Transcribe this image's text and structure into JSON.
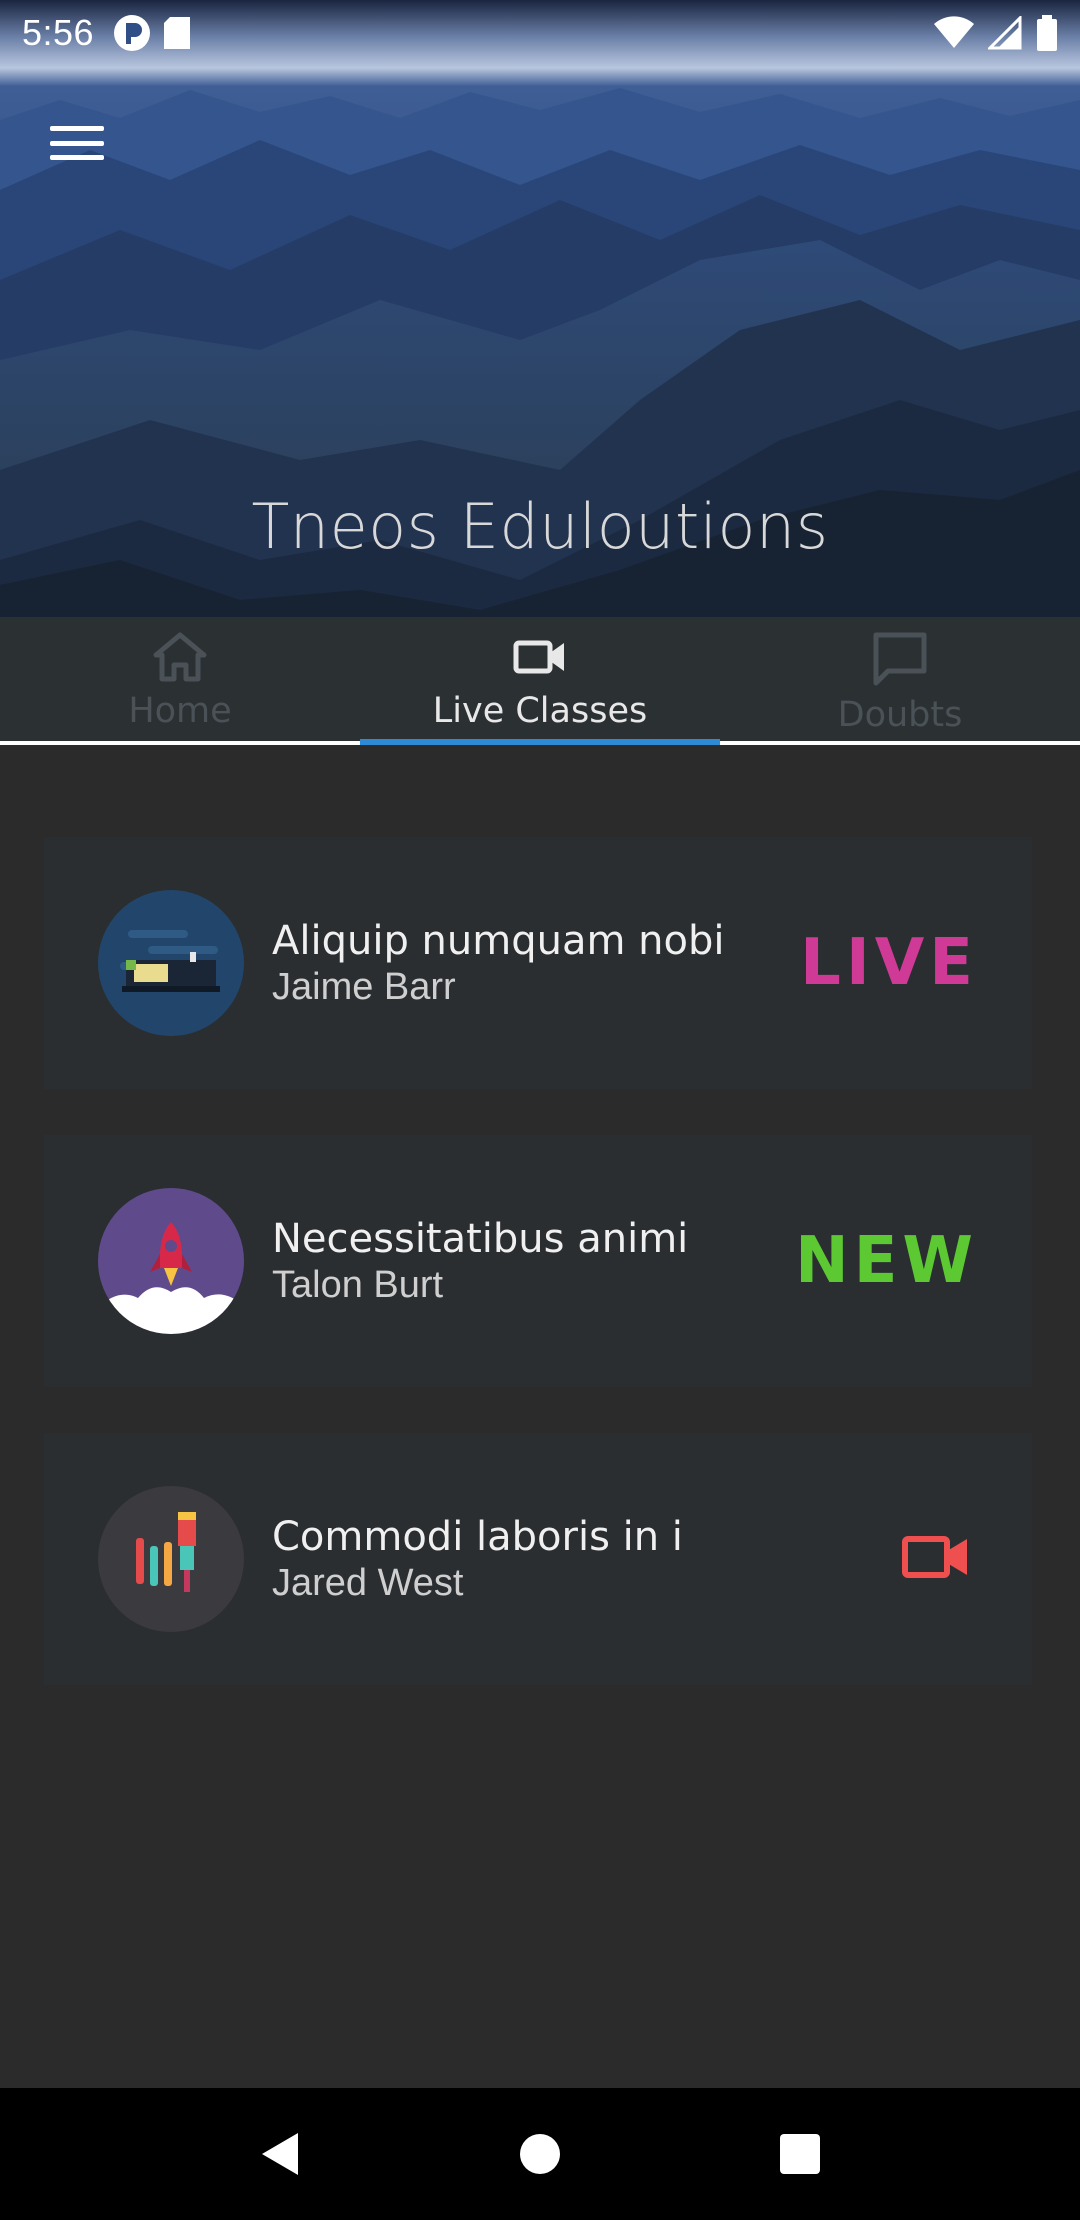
{
  "status_bar": {
    "time": "5:56"
  },
  "app": {
    "title": "Tneos Eduloutions"
  },
  "tabs": [
    {
      "label": "Home",
      "icon": "home-icon",
      "active": false
    },
    {
      "label": "Live Classes",
      "icon": "video-camera-icon",
      "active": true
    },
    {
      "label": "Doubts",
      "icon": "chat-bubble-icon",
      "active": false
    }
  ],
  "classes": [
    {
      "title": "Aliquip numquam nobi",
      "instructor": "Jaime Barr",
      "status": "LIVE",
      "status_color": "#d03a97",
      "avatar": "sleeping-bed-illustration"
    },
    {
      "title": "Necessitatibus animi",
      "instructor": "Talon Burt",
      "status": "NEW",
      "status_color": "#5cc832",
      "avatar": "rocket-launch-illustration"
    },
    {
      "title": "Commodi laboris in i",
      "instructor": "Jared West",
      "status_icon": "video-camera-icon",
      "status_color": "#ef4f4f",
      "avatar": "art-supplies-illustration"
    }
  ],
  "colors": {
    "tab_indicator": "#2f8ad6",
    "background": "#2c2b2b",
    "card": "#2a2e31",
    "tabbar": "#2b3033"
  }
}
